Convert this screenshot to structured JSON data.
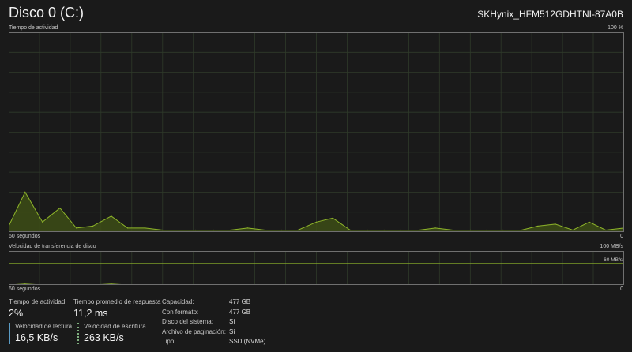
{
  "header": {
    "title": "Disco 0 (C:)",
    "model": "SKHynix_HFM512GDHTNI-87A0B"
  },
  "activity_chart": {
    "label": "Tiempo de actividad",
    "max_label": "100 %",
    "x_left": "60 segundos",
    "x_right": "0",
    "colors": {
      "line": "#8fb62a",
      "fill": "#3d4d16",
      "grid": "#2f3a2a",
      "border": "#707070"
    }
  },
  "transfer_chart": {
    "label": "Velocidad de transferencia de disco",
    "max_label": "100 MB/s",
    "secondary_label": "60 MB/s",
    "x_left": "60 segundos",
    "x_right": "0"
  },
  "chart_data": [
    {
      "type": "area",
      "ylabel": "Tiempo de actividad",
      "ylim": [
        0,
        100
      ],
      "x_range": [
        60,
        0
      ],
      "grid": true,
      "x": [
        60,
        58.4,
        56.7,
        55,
        53.4,
        51.8,
        50,
        48.4,
        46.7,
        45,
        43.4,
        41.8,
        40,
        38.4,
        36.7,
        35,
        33.4,
        31.8,
        30,
        28.4,
        26.7,
        25,
        23.4,
        21.8,
        20,
        18.4,
        16.7,
        15,
        13.4,
        11.8,
        10,
        8.4,
        6.7,
        5,
        3.4,
        1.8,
        0
      ],
      "values": [
        3,
        20,
        5,
        12,
        2,
        3,
        8,
        2,
        2,
        1,
        1,
        1,
        1,
        1,
        2,
        1,
        1,
        1,
        5,
        7,
        1,
        1,
        1,
        1,
        1,
        2,
        1,
        1,
        1,
        1,
        1,
        3,
        4,
        1,
        5,
        1,
        2
      ]
    },
    {
      "type": "area",
      "ylabel": "Velocidad de transferencia de disco",
      "ylim": [
        0,
        100
      ],
      "x_range": [
        60,
        0
      ],
      "grid": true,
      "x": [
        60,
        58.4,
        56.7,
        55,
        53.4,
        51.8,
        50,
        48.4,
        46.7,
        45,
        43.4,
        41.8,
        40,
        38.4,
        36.7,
        35,
        33.4,
        31.8,
        30,
        28.4,
        26.7,
        25,
        23.4,
        21.8,
        20,
        18.4,
        16.7,
        15,
        13.4,
        11.8,
        10,
        8.4,
        6.7,
        5,
        3.4,
        1.8,
        0
      ],
      "values": [
        0,
        3,
        0,
        1,
        0,
        0,
        3,
        0,
        0,
        0,
        0,
        0,
        0,
        0,
        0,
        0,
        0,
        0,
        0,
        0,
        0,
        0,
        0,
        0,
        0,
        0,
        0,
        0,
        0,
        0,
        0,
        0,
        1,
        0,
        1,
        0,
        0
      ]
    }
  ],
  "stats": {
    "activity_label": "Tiempo de actividad",
    "activity_value": "2%",
    "response_label": "Tiempo promedio de respuesta",
    "response_value": "11,2 ms",
    "read_label": "Velocidad de lectura",
    "read_value": "16,5 KB/s",
    "write_label": "Velocidad de escritura",
    "write_value": "263 KB/s"
  },
  "properties": [
    {
      "key": "Capacidad:",
      "value": "477 GB"
    },
    {
      "key": "Con formato:",
      "value": "477 GB"
    },
    {
      "key": "Disco del sistema:",
      "value": "Sí"
    },
    {
      "key": "Archivo de paginación:",
      "value": "Sí"
    },
    {
      "key": "Tipo:",
      "value": "SSD (NVMe)"
    }
  ]
}
